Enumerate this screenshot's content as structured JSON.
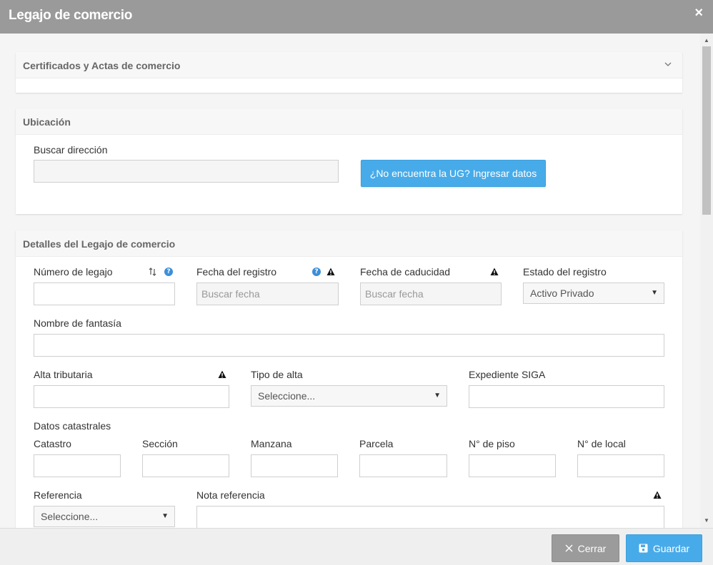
{
  "dialog": {
    "title": "Legajo de comercio",
    "close_glyph": "×"
  },
  "panels": {
    "certificados": {
      "title": "Certificados y Actas de comercio"
    },
    "ubicacion": {
      "title": "Ubicación",
      "search_label": "Buscar dirección",
      "search_value": "",
      "ug_button": "¿No encuentra la UG? Ingresar datos"
    },
    "detalles": {
      "title": "Detalles del Legajo de comercio",
      "numero_legajo": {
        "label": "Número de legajo",
        "value": ""
      },
      "fecha_registro": {
        "label": "Fecha del registro",
        "placeholder": "Buscar fecha"
      },
      "fecha_caducidad": {
        "label": "Fecha de caducidad",
        "placeholder": "Buscar fecha"
      },
      "estado_registro": {
        "label": "Estado del registro",
        "value": "Activo Privado"
      },
      "nombre_fantasia": {
        "label": "Nombre de fantasía",
        "value": ""
      },
      "alta_tributaria": {
        "label": "Alta tributaria",
        "value": ""
      },
      "tipo_alta": {
        "label": "Tipo de alta",
        "value": "Seleccione..."
      },
      "expediente_siga": {
        "label": "Expediente SIGA",
        "value": ""
      },
      "datos_catastrales": {
        "label": "Datos catastrales",
        "catastro": "Catastro",
        "seccion": "Sección",
        "manzana": "Manzana",
        "parcela": "Parcela",
        "piso": "N° de piso",
        "local": "N° de local"
      },
      "referencia": {
        "label": "Referencia",
        "value": "Seleccione..."
      },
      "nota_referencia": {
        "label": "Nota referencia",
        "value": ""
      }
    }
  },
  "footer": {
    "close_label": "Cerrar",
    "save_label": "Guardar"
  },
  "icons": {
    "close": "close-icon",
    "chevron": "chevron-down-icon",
    "sort": "sort-icon",
    "help": "help-icon",
    "warning": "warning-icon",
    "save": "floppy-disk-icon",
    "x": "x-icon"
  },
  "colors": {
    "primary": "#48abe9",
    "titlebar": "#9a9a9a",
    "help": "#3d8fd8"
  }
}
